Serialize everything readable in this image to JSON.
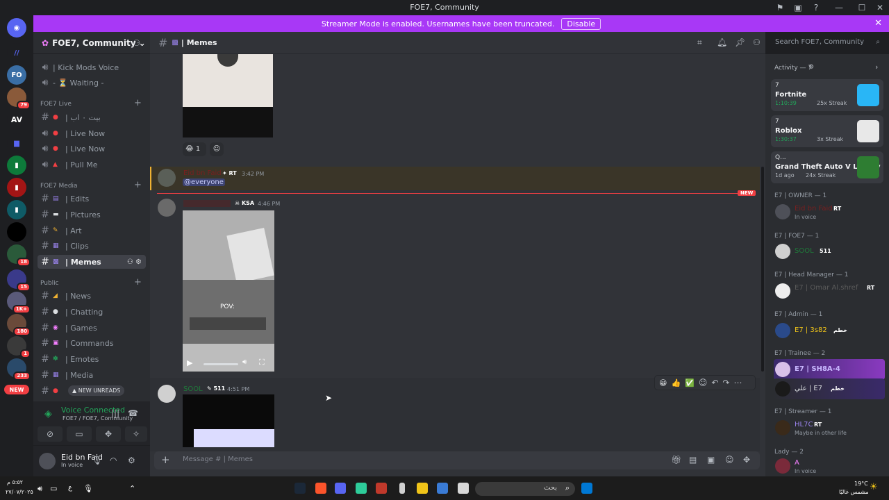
{
  "window": {
    "title": "FOE7, Community"
  },
  "banner": {
    "text": "Streamer Mode is enabled. Usernames have been truncated.",
    "button": "Disable"
  },
  "guilds": {
    "badges": [
      "79",
      "18",
      "15",
      "1K+",
      "180",
      "1",
      "233"
    ],
    "text_icon": "AV",
    "new_label": "NEW"
  },
  "server": {
    "name": "FOE7, Community"
  },
  "channels": {
    "top": [
      {
        "label": "| Kick Mods Voice"
      },
      {
        "label": "- ⏳ Waiting -"
      }
    ],
    "live_category": "FOE7 Live",
    "live": [
      {
        "label": "| بيت ۰ اب"
      },
      {
        "label": "| Live Now"
      },
      {
        "label": "| Live Now"
      },
      {
        "label": "| Pull Me"
      }
    ],
    "media_category": "FOE7 Media",
    "media": [
      {
        "label": "| Edits"
      },
      {
        "label": "| Pictures"
      },
      {
        "label": "| Art"
      },
      {
        "label": "| Clips"
      },
      {
        "label": "| Memes"
      }
    ],
    "public_category": "Public",
    "public": [
      {
        "label": "| News"
      },
      {
        "label": "| Chatting"
      },
      {
        "label": "| Games"
      },
      {
        "label": "| Commands"
      },
      {
        "label": "| Emotes"
      },
      {
        "label": "| Media"
      }
    ],
    "new_unreads": "NEW UNREADS"
  },
  "voice": {
    "status": "Voice Connected",
    "location": "FOE7 / FOE7, Community"
  },
  "user": {
    "name": "Eid bn Faid",
    "status": "In voice"
  },
  "channel_header": {
    "name": "| Memes",
    "search_placeholder": "Search FOE7, Community"
  },
  "messages": {
    "reaction_count": "1",
    "m1": {
      "author": "Eid bn Faid",
      "tag": "RT",
      "time": "3:42 PM",
      "mention": "@everyone"
    },
    "new_label": "NEW",
    "m2": {
      "tag": "KSA",
      "time": "4:46 PM"
    },
    "m3": {
      "author": "SOOL",
      "tag": "511",
      "time": "4:51 PM"
    },
    "video_overlay": "POV:"
  },
  "composer": {
    "placeholder": "Message # | Memes"
  },
  "activity": {
    "header": "Activity — 7",
    "cards": [
      {
        "count": "7",
        "game": "Fortnite",
        "time": "1:10:39",
        "streak": "25x Streak",
        "color": "#29b6f6"
      },
      {
        "count": "7",
        "game": "Roblox",
        "time": "1:30:37",
        "streak": "3x Streak",
        "color": "#e8e8e8"
      },
      {
        "count": "Q...",
        "game": "Grand Theft Auto V Legacy",
        "time": "1d ago",
        "streak": "24x Streak",
        "color": "#2e7d32"
      }
    ]
  },
  "member_groups": [
    {
      "header": "E7 | OWNER — 1",
      "members": [
        {
          "name": "Eid bn Faid",
          "tag": "RT",
          "sub": "In voice",
          "color": "#7a1f1f"
        }
      ]
    },
    {
      "header": "E7 | FOE7 — 1",
      "members": [
        {
          "name": "SOOL",
          "tag": "511",
          "sub": "",
          "color": "#1f7a3a"
        }
      ]
    },
    {
      "header": "E7 | Head Manager — 1",
      "members": [
        {
          "name": "E7 | Omar Al.shref",
          "tag": "RT",
          "sub": "",
          "color": "#5a5a5a"
        }
      ]
    },
    {
      "header": "E7 | Admin — 1",
      "members": [
        {
          "name": "E7 | 3s82",
          "tag": "خطم",
          "sub": "",
          "color": "#f0c419"
        }
      ]
    },
    {
      "header": "E7 | Trainee — 2",
      "members": [
        {
          "name": "E7 | SH8A-4",
          "tag": "",
          "sub": "",
          "color": "#c9b8ff"
        },
        {
          "name": "علي | E7",
          "tag": "خطم",
          "sub": "",
          "color": "#dbdee1"
        }
      ]
    },
    {
      "header": "E7 | Streamer — 1",
      "members": [
        {
          "name": "HL7C",
          "tag": "RT",
          "sub": "Maybe in other life",
          "color": "#9b84ee"
        }
      ]
    },
    {
      "header": "Lady — 2",
      "members": [
        {
          "name": "A",
          "tag": "",
          "sub": "In voice",
          "color": "#f47fff"
        }
      ]
    }
  ],
  "taskbar": {
    "search_placeholder": "بحث",
    "time": "٥:٥٢ م",
    "date": "٢٧/٠٧/٢٠٢٥",
    "weather_temp": "19°C",
    "weather_desc": "مشمس غالبًا",
    "lang": "ع"
  }
}
